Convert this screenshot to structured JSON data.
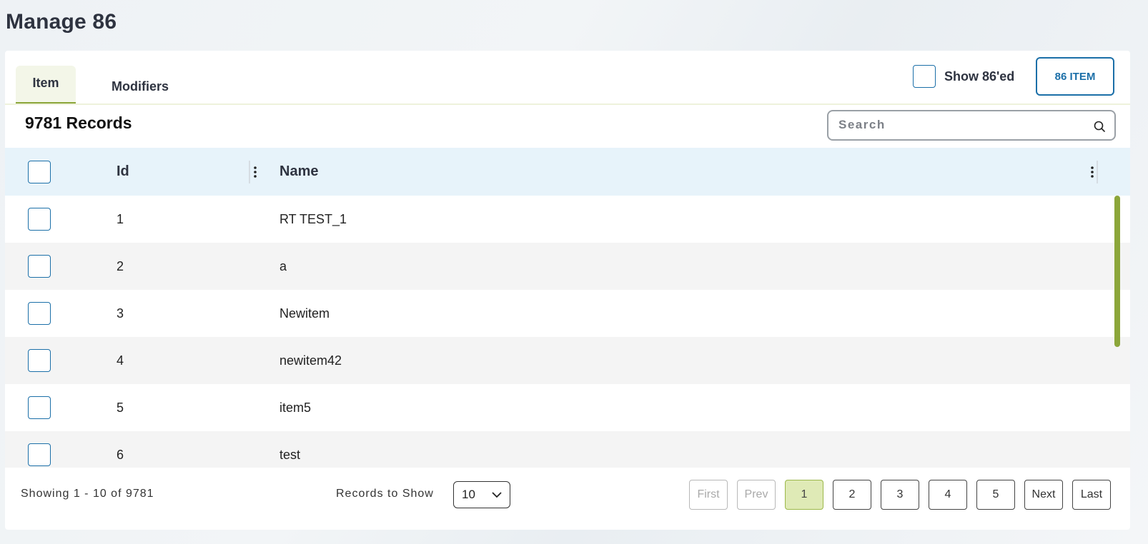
{
  "page": {
    "title": "Manage 86"
  },
  "tabs": [
    {
      "label": "Item",
      "active": true
    },
    {
      "label": "Modifiers",
      "active": false
    }
  ],
  "toolbar": {
    "show_86ed_label": "Show 86'ed",
    "show_86ed_checked": false,
    "button_86_item": "86 ITEM"
  },
  "records": {
    "title": "9781 Records"
  },
  "search": {
    "placeholder": "Search",
    "value": ""
  },
  "table": {
    "columns": {
      "id": "Id",
      "name": "Name"
    },
    "rows": [
      {
        "id": "1",
        "name": "RT TEST_1"
      },
      {
        "id": "2",
        "name": "a"
      },
      {
        "id": "3",
        "name": "Newitem"
      },
      {
        "id": "4",
        "name": "newitem42"
      },
      {
        "id": "5",
        "name": "item5"
      },
      {
        "id": "6",
        "name": "test"
      }
    ]
  },
  "footer": {
    "showing": "Showing 1 - 10 of 9781",
    "records_to_show_label": "Records to Show",
    "records_to_show_value": "10"
  },
  "pagination": {
    "first": "First",
    "prev": "Prev",
    "pages": [
      "1",
      "2",
      "3",
      "4",
      "5"
    ],
    "current": "1",
    "next": "Next",
    "last": "Last"
  },
  "colors": {
    "accent_green": "#8ca63a",
    "accent_blue": "#1b6fa8",
    "header_bg": "#e7f3fa",
    "current_page_bg": "#dfeab6"
  }
}
